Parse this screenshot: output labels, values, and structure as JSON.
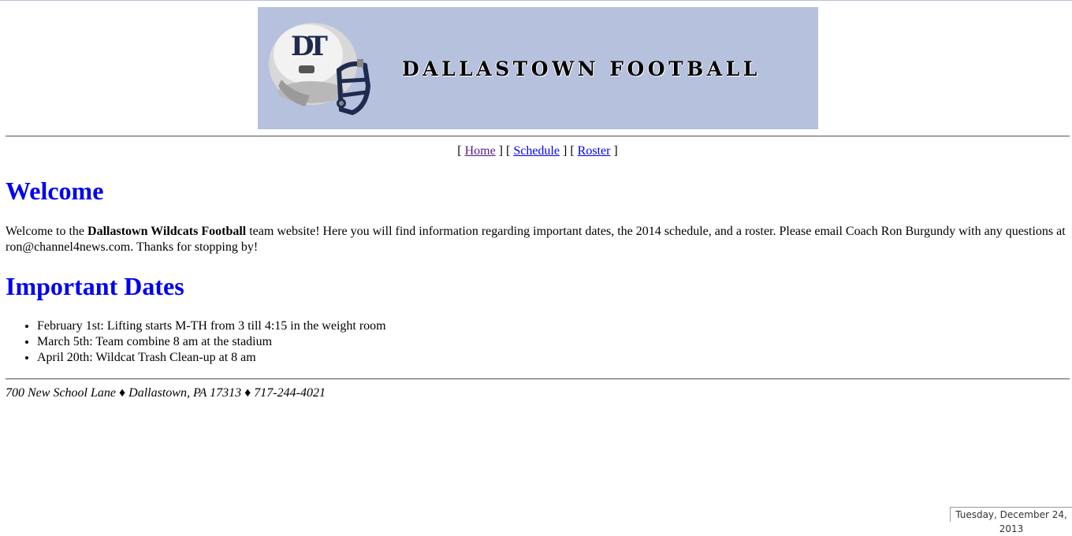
{
  "banner": {
    "title": "DALLASTOWN FOOTBALL",
    "logo_text": "DT",
    "background_color": "#b6c1dd",
    "helmet_icon": "football-helmet-icon"
  },
  "nav": {
    "open_bracket": "[",
    "close_bracket": "]",
    "home": "Home",
    "schedule": "Schedule",
    "roster": "Roster"
  },
  "welcome": {
    "heading": "Welcome",
    "intro": "Welcome to the ",
    "team_name": "Dallastown Wildcats Football",
    "body": " team website! Here you will find information regarding important dates, the 2014 schedule, and a roster. Please email Coach Ron Burgundy with any questions at ron@channel4news.com. Thanks for stopping by!"
  },
  "important_dates": {
    "heading": "Important Dates",
    "items": [
      "February 1st: Lifting starts M-TH from 3 till 4:15 in the weight room",
      "March 5th: Team combine 8 am at the stadium",
      "April 20th: Wildcat Trash Clean-up at 8 am"
    ]
  },
  "footer": {
    "address": "700 New School Lane ♦ Dallastown, PA 17313 ♦ 717-244-4021"
  },
  "status": {
    "date": "Tuesday, December 24, 2013"
  },
  "colors": {
    "heading": "#0000ee",
    "link": "#0000ee",
    "visited_link": "#551a8b"
  }
}
